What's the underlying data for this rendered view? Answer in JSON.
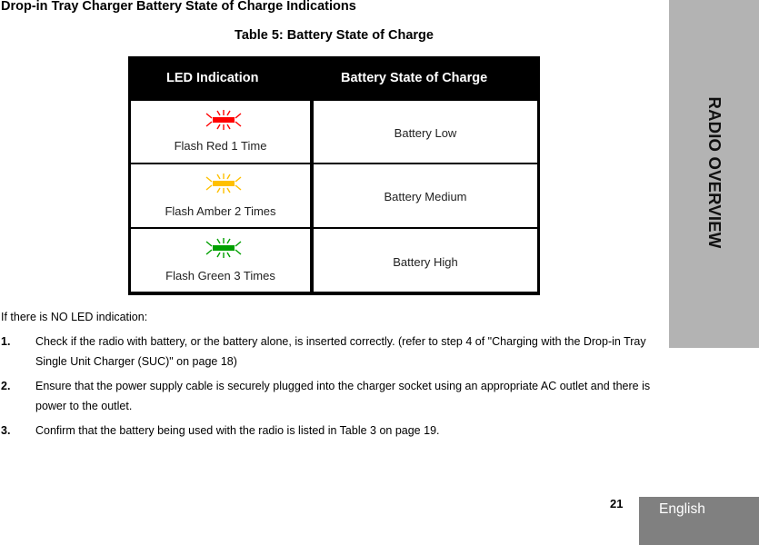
{
  "section_title": "Drop-in Tray Charger Battery State of Charge Indications",
  "table": {
    "caption": "Table 5: Battery State of Charge",
    "headers": [
      "LED Indication",
      "Battery State of Charge"
    ],
    "rows": [
      {
        "led_icon": "led-flash-red-icon",
        "led_color": "#ff0000",
        "indication": "Flash Red 1 Time",
        "state": "Battery Low"
      },
      {
        "led_icon": "led-flash-amber-icon",
        "led_color": "#ffc000",
        "indication": "Flash Amber 2 Times",
        "state": "Battery Medium"
      },
      {
        "led_icon": "led-flash-green-icon",
        "led_color": "#00a000",
        "indication": "Flash Green 3 Times",
        "state": "Battery High"
      }
    ]
  },
  "intro": "If there is NO LED indication:",
  "steps": [
    {
      "num": "1.",
      "text": "Check if the radio with battery, or the battery alone, is inserted correctly. (refer to step 4 of \"Charging with the Drop-in Tray Single Unit Charger (SUC)\" on page 18)"
    },
    {
      "num": "2.",
      "text": "Ensure that the power supply cable is securely plugged into the charger socket using an appropriate AC outlet and there is power to the outlet."
    },
    {
      "num": "3.",
      "text": "Confirm that the battery being used with the radio is listed in Table 3 on page 19."
    }
  ],
  "side_tab": "RADIO OVERVIEW",
  "page_number": "21",
  "language_tab": "English"
}
